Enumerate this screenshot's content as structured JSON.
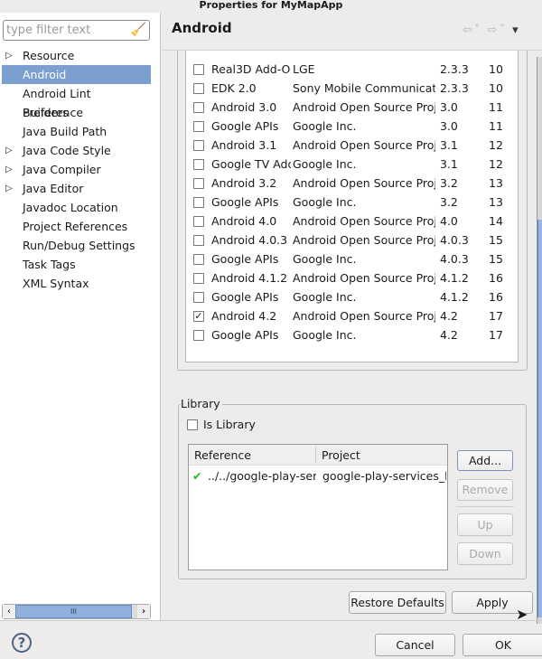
{
  "window": {
    "title": "Properties for MyMapApp"
  },
  "sidebar": {
    "filter_placeholder": "type filter text",
    "items": [
      {
        "label": "Resource",
        "expandable": true
      },
      {
        "label": "Android",
        "selected": true
      },
      {
        "label": "Android Lint Preference"
      },
      {
        "label": "Builders"
      },
      {
        "label": "Java Build Path"
      },
      {
        "label": "Java Code Style",
        "expandable": true
      },
      {
        "label": "Java Compiler",
        "expandable": true
      },
      {
        "label": "Java Editor",
        "expandable": true
      },
      {
        "label": "Javadoc Location"
      },
      {
        "label": "Project References"
      },
      {
        "label": "Run/Debug Settings"
      },
      {
        "label": "Task Tags"
      },
      {
        "label": "XML Syntax"
      }
    ],
    "scroll_grip": "III"
  },
  "page": {
    "title": "Android"
  },
  "targets": [
    {
      "name": "Real3D Add-O",
      "vendor": "LGE",
      "platform": "2.3.3",
      "api": "10",
      "checked": false
    },
    {
      "name": "EDK 2.0",
      "vendor": "Sony Mobile Communicati",
      "platform": "2.3.3",
      "api": "10",
      "checked": false
    },
    {
      "name": "Android 3.0",
      "vendor": "Android Open Source Proj",
      "platform": "3.0",
      "api": "11",
      "checked": false
    },
    {
      "name": "Google APIs",
      "vendor": "Google Inc.",
      "platform": "3.0",
      "api": "11",
      "checked": false
    },
    {
      "name": "Android 3.1",
      "vendor": "Android Open Source Proj",
      "platform": "3.1",
      "api": "12",
      "checked": false
    },
    {
      "name": "Google TV Add",
      "vendor": "Google Inc.",
      "platform": "3.1",
      "api": "12",
      "checked": false
    },
    {
      "name": "Android 3.2",
      "vendor": "Android Open Source Proj",
      "platform": "3.2",
      "api": "13",
      "checked": false
    },
    {
      "name": "Google APIs",
      "vendor": "Google Inc.",
      "platform": "3.2",
      "api": "13",
      "checked": false
    },
    {
      "name": "Android 4.0",
      "vendor": "Android Open Source Proj",
      "platform": "4.0",
      "api": "14",
      "checked": false
    },
    {
      "name": "Android 4.0.3",
      "vendor": "Android Open Source Proj",
      "platform": "4.0.3",
      "api": "15",
      "checked": false
    },
    {
      "name": "Google APIs",
      "vendor": "Google Inc.",
      "platform": "4.0.3",
      "api": "15",
      "checked": false
    },
    {
      "name": "Android 4.1.2",
      "vendor": "Android Open Source Proj",
      "platform": "4.1.2",
      "api": "16",
      "checked": false
    },
    {
      "name": "Google APIs",
      "vendor": "Google Inc.",
      "platform": "4.1.2",
      "api": "16",
      "checked": false
    },
    {
      "name": "Android 4.2",
      "vendor": "Android Open Source Proj",
      "platform": "4.2",
      "api": "17",
      "checked": true
    },
    {
      "name": "Google APIs",
      "vendor": "Google Inc.",
      "platform": "4.2",
      "api": "17",
      "checked": false
    }
  ],
  "library": {
    "group_label": "Library",
    "is_library_label": "Is Library",
    "is_library": false,
    "columns": [
      "Reference",
      "Project"
    ],
    "rows": [
      {
        "reference": "../../google-play-serv",
        "project": "google-play-services_lib",
        "status": "ok"
      }
    ],
    "buttons": {
      "add": "Add...",
      "remove": "Remove",
      "up": "Up",
      "down": "Down"
    }
  },
  "footer": {
    "restore": "Restore Defaults",
    "apply": "Apply",
    "cancel": "Cancel",
    "ok": "OK",
    "help": "?"
  },
  "colors": {
    "selection": "#7b9fcf",
    "check_ok": "#22bb22"
  }
}
